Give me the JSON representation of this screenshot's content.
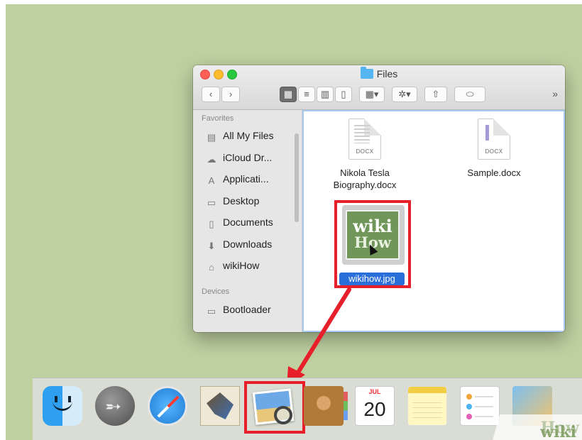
{
  "window": {
    "title": "Files",
    "toolbar": {
      "back_icon": "‹",
      "forward_icon": "›",
      "more_label": "»"
    },
    "sidebar": {
      "favorites_heading": "Favorites",
      "items": [
        {
          "label": "All My Files",
          "icon": "all-files-icon"
        },
        {
          "label": "iCloud Dr...",
          "icon": "cloud-icon"
        },
        {
          "label": "Applicati...",
          "icon": "applications-icon"
        },
        {
          "label": "Desktop",
          "icon": "desktop-icon"
        },
        {
          "label": "Documents",
          "icon": "documents-icon"
        },
        {
          "label": "Downloads",
          "icon": "downloads-icon"
        },
        {
          "label": "wikiHow",
          "icon": "home-icon"
        }
      ],
      "devices_heading": "Devices",
      "devices": [
        {
          "label": "Bootloader",
          "icon": "disk-icon"
        }
      ]
    },
    "files": [
      {
        "name_line1": "Nikola Tesla",
        "name_line2": "Biography.docx",
        "ext": "DOCX"
      },
      {
        "name_line1": "Sample.docx",
        "ext": "DOCX"
      },
      {
        "name_line1": "wikihow.jpg",
        "selected": true,
        "thumb_top": "wiki",
        "thumb_bottom": "How"
      }
    ]
  },
  "dock": {
    "calendar_month": "JUL",
    "calendar_day": "20",
    "apps": [
      "finder",
      "launchpad",
      "safari",
      "mail",
      "preview",
      "contacts",
      "calendar",
      "notes",
      "reminders",
      "photos"
    ]
  },
  "watermark": {
    "wiki": "wiki",
    "how": "How"
  },
  "colors": {
    "highlight": "#e61f2a",
    "selection": "#2a6fd9",
    "background": "#bfd1a1"
  }
}
